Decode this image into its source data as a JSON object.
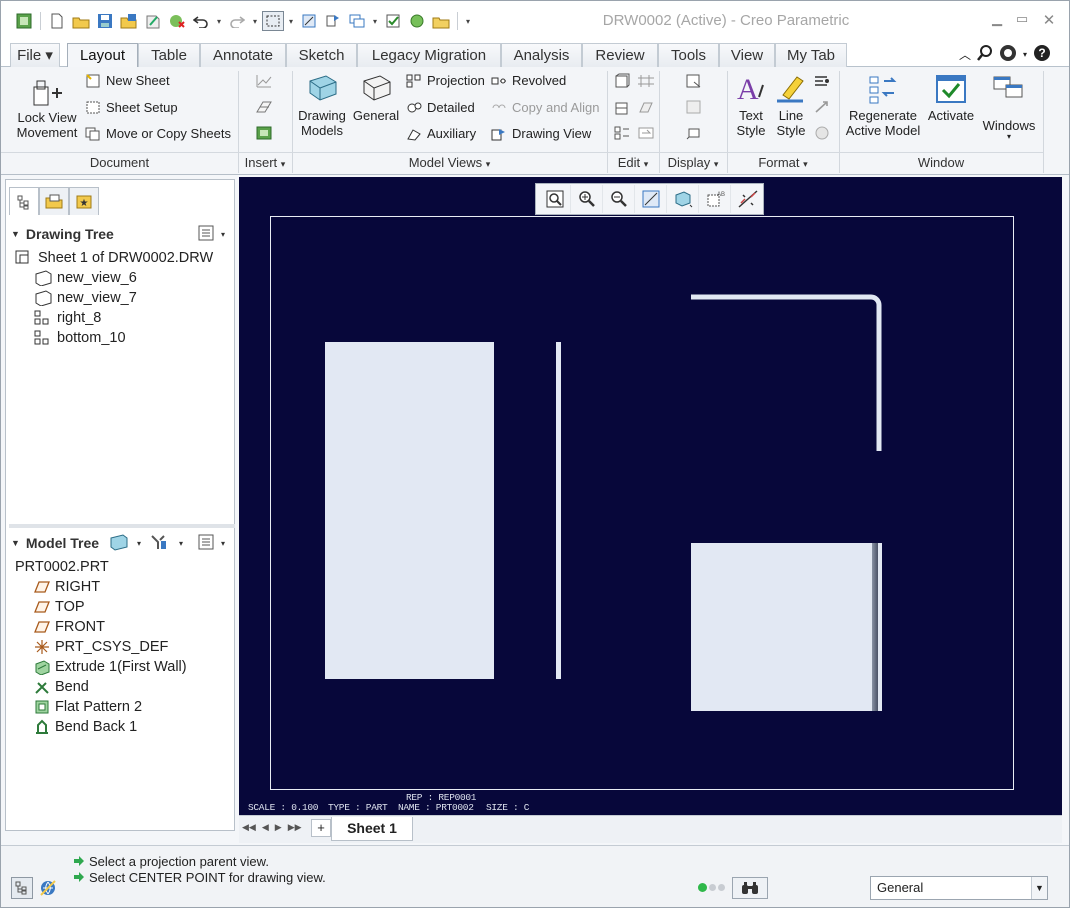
{
  "window": {
    "title": "DRW0002 (Active) - Creo Parametric"
  },
  "tabs": [
    "File",
    "Layout",
    "Table",
    "Annotate",
    "Sketch",
    "Legacy Migration",
    "Analysis",
    "Review",
    "Tools",
    "View",
    "My Tab"
  ],
  "active_tab": "Layout",
  "ribbon": {
    "document": {
      "lock_view_movement": [
        "Lock View",
        "Movement"
      ],
      "new_sheet": "New Sheet",
      "sheet_setup": "Sheet Setup",
      "move_copy_sheets": "Move or Copy Sheets",
      "group": "Document"
    },
    "insert": {
      "group": "Insert"
    },
    "model_views": {
      "drawing_models": [
        "Drawing",
        "Models"
      ],
      "general": "General",
      "projection": "Projection",
      "detailed": "Detailed",
      "auxiliary": "Auxiliary",
      "revolved": "Revolved",
      "copy_align": "Copy and Align",
      "drawing_view": "Drawing View",
      "group": "Model Views"
    },
    "edit": {
      "group": "Edit"
    },
    "display": {
      "group": "Display"
    },
    "format": {
      "text_style": [
        "Text",
        "Style"
      ],
      "line_style": [
        "Line",
        "Style"
      ],
      "group": "Format"
    },
    "window": {
      "regenerate": [
        "Regenerate",
        "Active Model"
      ],
      "activate": "Activate",
      "windows": "Windows",
      "group": "Window"
    }
  },
  "drawing_tree": {
    "header": "Drawing Tree",
    "sheet": "Sheet 1 of DRW0002.DRW",
    "views": [
      "new_view_6",
      "new_view_7",
      "right_8",
      "bottom_10"
    ]
  },
  "model_tree": {
    "header": "Model Tree",
    "root": "PRT0002.PRT",
    "items": [
      "RIGHT",
      "TOP",
      "FRONT",
      "PRT_CSYS_DEF",
      "Extrude 1(First Wall)",
      "Bend",
      "Flat Pattern 2",
      "Bend Back 1"
    ]
  },
  "drawing_info": {
    "scale": "SCALE : 0.100",
    "type": "TYPE : PART",
    "rep": "REP : REP0001",
    "name": "NAME : PRT0002",
    "size": "SIZE : C"
  },
  "sheet_tab": "Sheet 1",
  "status": {
    "messages": [
      "Select a projection parent view.",
      "Select CENTER POINT for drawing view."
    ],
    "filter": "General"
  },
  "colors": {
    "graphics_bg": "#07073a",
    "view_fill": "#e2e8f3",
    "border": "#e8ecf4"
  }
}
